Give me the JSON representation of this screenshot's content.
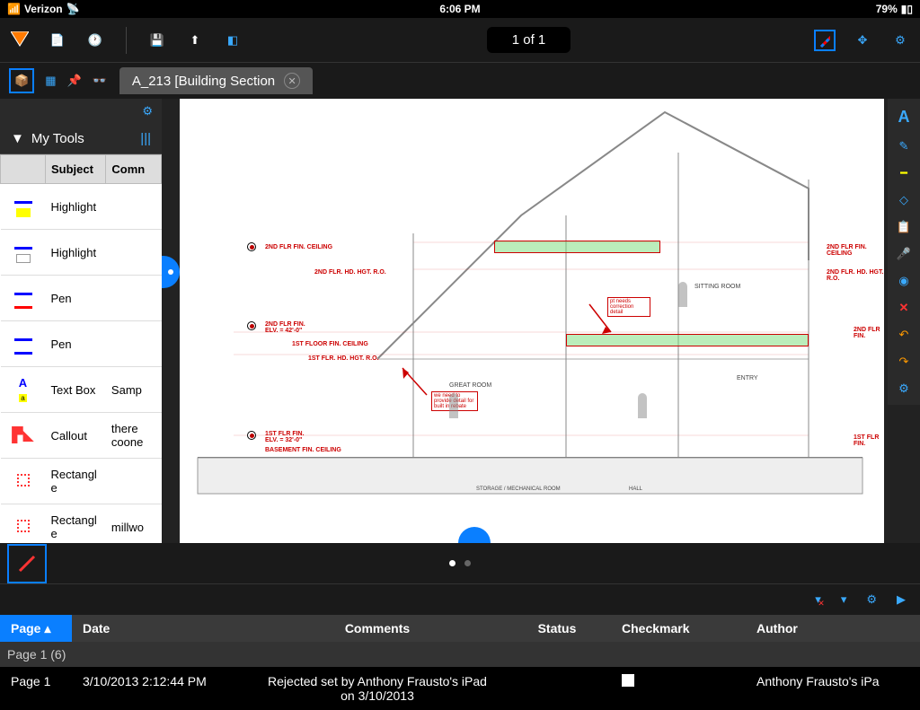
{
  "status": {
    "carrier": "Verizon",
    "time": "6:06 PM",
    "battery": "79%"
  },
  "toolbar": {
    "page_counter": "1 of 1"
  },
  "doc": {
    "tab_title": "A_213 [Building Section"
  },
  "sidebar": {
    "title": "My Tools",
    "columns": {
      "c0": "",
      "c1": "Subject",
      "c2": "Comn"
    },
    "items": [
      {
        "icon": "yellow-hl",
        "subject": "Highlight",
        "comment": ""
      },
      {
        "icon": "white-hl",
        "subject": "Highlight",
        "comment": ""
      },
      {
        "icon": "pen-red",
        "subject": "Pen",
        "comment": ""
      },
      {
        "icon": "pen-blue",
        "subject": "Pen",
        "comment": ""
      },
      {
        "icon": "textbox",
        "subject": "Text Box",
        "comment": "Samp"
      },
      {
        "icon": "callout",
        "subject": "Callout",
        "comment": "there coone"
      },
      {
        "icon": "rectangle",
        "subject": "Rectangl e",
        "comment": ""
      },
      {
        "icon": "rectangle",
        "subject": "Rectangl e",
        "comment": "millwo"
      }
    ]
  },
  "drawing_labels": {
    "flr2_ceiling": "2ND FLR FIN. CEILING",
    "flr2_hd": "2ND FLR. HD. HGT. R.O.",
    "flr2_fin": "2ND FLR FIN.\nELV. = 42'-0\"",
    "flr1_ceiling": "1ST FLOOR FIN. CEILING",
    "flr1_hd": "1ST FLR. HD. HGT. R.O.",
    "flr1_fin": "1ST FLR FIN.\nELV. = 32'-0\"",
    "basement": "BASEMENT FIN. CEILING",
    "sitting": "SITTING ROOM",
    "great": "GREAT ROOM",
    "entry": "ENTRY",
    "mech": "STORAGE / MECHANICAL ROOM",
    "hall": "HALL",
    "callout1": "we need to provide detail for built in rebate",
    "callout2": "pt needs correction detail",
    "flr2_ceiling_r": "2ND FLR FIN. CEILING",
    "flr2_hd_r": "2ND FLR. HD. HGT. R.O.",
    "flr2_fin_r": "2ND FLR FIN.",
    "flr1_fin_r": "1ST FLR FIN."
  },
  "comments": {
    "headers": {
      "page": "Page",
      "date": "Date",
      "comments": "Comments",
      "status": "Status",
      "checkmark": "Checkmark",
      "author": "Author"
    },
    "summary": "Page 1 (6)",
    "rows": [
      {
        "page": "Page 1",
        "date": "3/10/2013 2:12:44 PM",
        "comment": "Rejected set by Anthony Frausto's iPad on 3/10/2013",
        "status": "",
        "checked": false,
        "author": "Anthony Frausto's iPa"
      }
    ]
  }
}
